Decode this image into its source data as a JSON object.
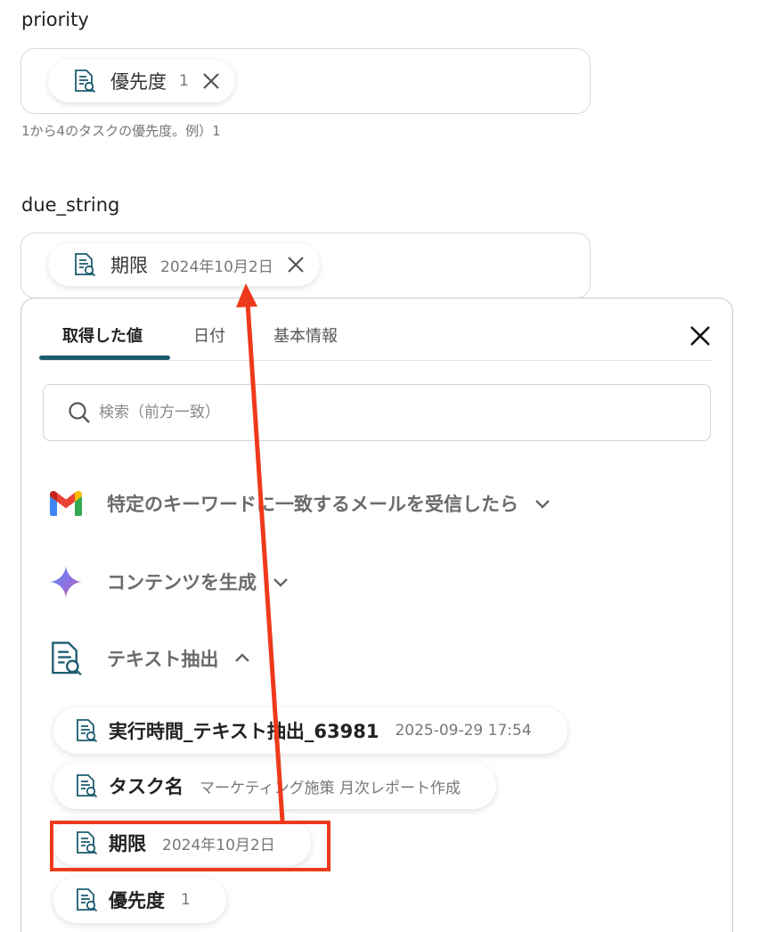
{
  "fields": {
    "priority": {
      "label": "priority",
      "chip": {
        "name": "優先度",
        "value": "1",
        "icon": "text-extract-icon"
      },
      "hint": "1から4のタスクの優先度。例）1"
    },
    "due_string": {
      "label": "due_string",
      "chip": {
        "name": "期限",
        "value": "2024年10月2日",
        "icon": "text-extract-icon"
      }
    }
  },
  "panel": {
    "tabs": [
      {
        "label": "取得した値",
        "active": true
      },
      {
        "label": "日付",
        "active": false
      },
      {
        "label": "基本情報",
        "active": false
      }
    ],
    "search": {
      "placeholder": "検索（前方一致）"
    },
    "sections": [
      {
        "title": "特定のキーワードに一致するメールを受信したら",
        "icon": "gmail-icon",
        "expanded": false
      },
      {
        "title": "コンテンツを生成",
        "icon": "gemini-icon",
        "expanded": false
      },
      {
        "title": "テキスト抽出",
        "icon": "text-extract-icon",
        "expanded": true
      }
    ],
    "outputs": [
      {
        "name": "実行時間_テキスト抽出_63981",
        "value": "2025-09-29 17:54"
      },
      {
        "name": "タスク名",
        "value": "マーケティング施策 月次レポート作成"
      },
      {
        "name": "期限",
        "value": "2024年10月2日"
      },
      {
        "name": "優先度",
        "value": "1"
      }
    ]
  },
  "annotation": {
    "highlight_color": "#ee3a1c"
  },
  "colors": {
    "tab_accent": "#1d5c70",
    "icon_teal": "#1d5c70"
  }
}
